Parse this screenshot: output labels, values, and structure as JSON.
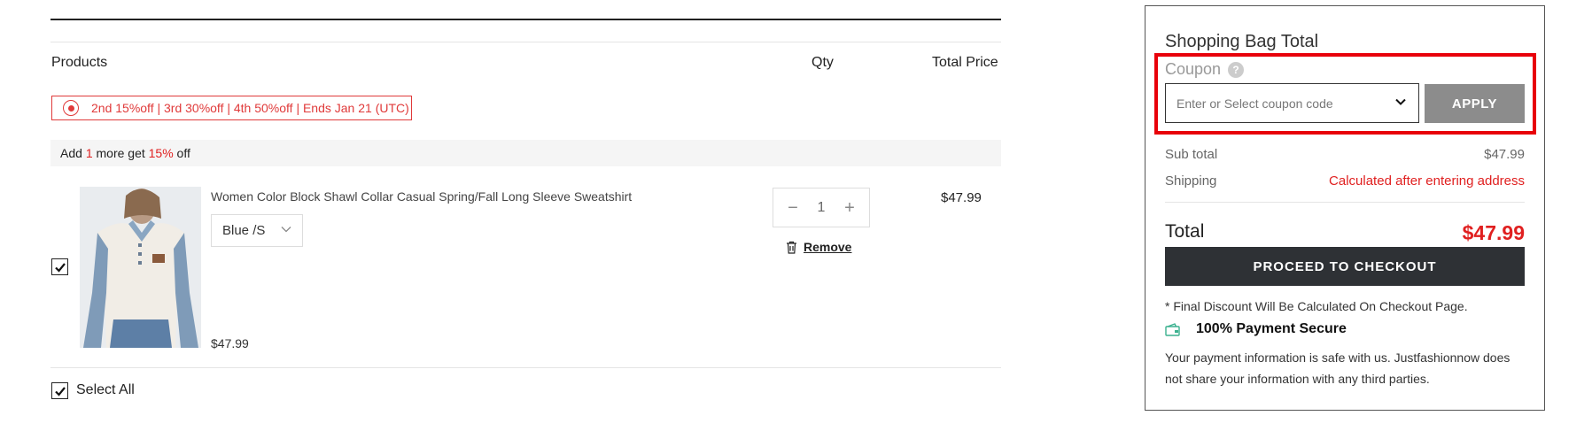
{
  "cart": {
    "headers": {
      "products": "Products",
      "qty": "Qty",
      "total_price": "Total Price"
    },
    "promo": {
      "icon": "discount-tag-icon",
      "text": "2nd 15%off | 3rd 30%off | 4th 50%off | Ends Jan 21 (UTC)"
    },
    "add_more": {
      "prefix": "Add ",
      "count": "1",
      "middle": " more get ",
      "discount": "15%",
      "suffix": " off"
    },
    "item": {
      "checked": true,
      "title": "Women Color Block Shawl Collar Casual Spring/Fall Long Sleeve Sweatshirt",
      "variant": "Blue /S",
      "price": "$47.99",
      "quantity": "1",
      "minus": "−",
      "plus": "+",
      "remove_label": "Remove",
      "line_total": "$47.99"
    },
    "select_all": {
      "checked": true,
      "label": "Select All"
    }
  },
  "summary": {
    "title": "Shopping Bag Total",
    "coupon": {
      "label": "Coupon",
      "help": "?",
      "placeholder": "Enter or Select coupon code",
      "apply_label": "APPLY"
    },
    "subtotal": {
      "label": "Sub total",
      "value": "$47.99"
    },
    "shipping": {
      "label": "Shipping",
      "value": "Calculated after entering address"
    },
    "total": {
      "label": "Total",
      "value": "$47.99"
    },
    "checkout_label": "PROCEED TO CHECKOUT",
    "note": "* Final Discount Will Be Calculated On Checkout Page.",
    "secure_label": "100% Payment Secure",
    "info": "Your payment information is safe with us. Justfashionnow does not share your information with any third parties."
  },
  "colors": {
    "accent_red": "#e02020",
    "highlight_red": "#e8000a",
    "checkout_bg": "#2e3135",
    "apply_bg": "#8c8c8c",
    "secure_green": "#3bb18f"
  }
}
